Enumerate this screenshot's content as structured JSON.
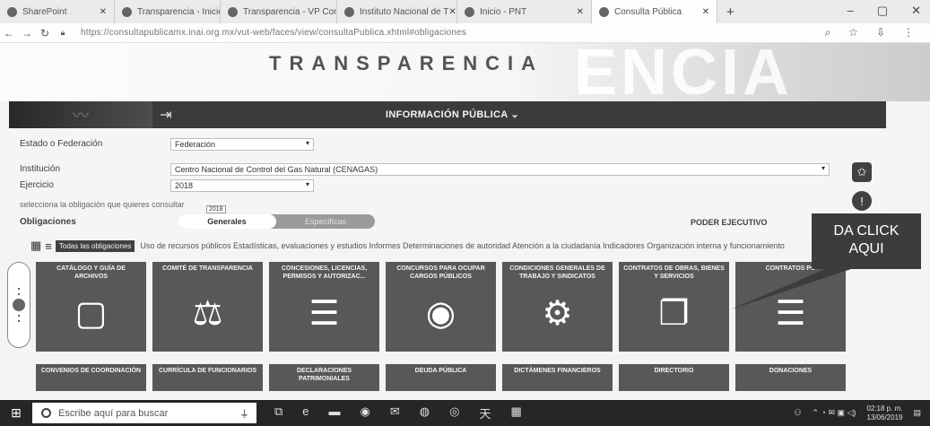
{
  "browser": {
    "tabs": [
      {
        "title": "SharePoint",
        "icon": "sharepoint-icon"
      },
      {
        "title": "Transparencia - Inicio",
        "icon": "sharepoint-icon"
      },
      {
        "title": "Transparencia - VP Con",
        "icon": "sharepoint-icon"
      },
      {
        "title": "Instituto Nacional de T",
        "icon": "globe-icon"
      },
      {
        "title": "Inicio - PNT",
        "icon": "pnt-icon"
      },
      {
        "title": "Consulta Pública",
        "icon": "globe-icon"
      }
    ],
    "url": "https://consultapublicamx.inai.org.mx/vut-web/faces/view/consultaPublica.xhtml#obligaciones"
  },
  "header": {
    "title": "TRANSPARENCIA",
    "ghost_text": "ENCIA"
  },
  "navbar": {
    "title": "INFORMACIÓN PÚBLICA ⌄"
  },
  "form": {
    "estado_label": "Estado o Federación",
    "estado_value": "Federación",
    "institucion_label": "Institución",
    "institucion_value": "Centro Nacional de Control del Gas Natural (CENAGAS)",
    "ejercicio_label": "Ejercicio",
    "ejercicio_value": "2018",
    "tooltip": "2018",
    "hint": "selecciona la obligación que quieres consultar",
    "obligaciones_label": "Obligaciones",
    "toggle_on": "Generales",
    "toggle_off": "Específicas",
    "poder": "PODER EJECUTIVO"
  },
  "filters": {
    "chip": "Todas las obligaciones",
    "text": "Uso de recursos públicos  Estadísticas, evaluaciones y estudios  Informes  Determinaciones de autoridad  Atención a la ciudadanía  Indicadores  Organización interna y funcionamiento"
  },
  "tiles": [
    {
      "title": "CATÁLOGO Y GUÍA DE ARCHIVOS",
      "icon": "document-icon",
      "glyph": "▢"
    },
    {
      "title": "COMITÉ DE TRANSPARENCIA",
      "icon": "gavel-document-icon",
      "glyph": "⚖"
    },
    {
      "title": "CONCESIONES, LICENCIAS, PERMISOS Y AUTORIZAC...",
      "icon": "id-document-icon",
      "glyph": "☰"
    },
    {
      "title": "CONCURSOS PARA OCUPAR CARGOS PÚBLICOS",
      "icon": "search-person-icon",
      "glyph": "◉"
    },
    {
      "title": "CONDICIONES GENERALES DE TRABAJO Y SINDICATOS",
      "icon": "gears-icon",
      "glyph": "⚙"
    },
    {
      "title": "CONTRATOS DE OBRAS, BIENES Y SERVICIOS",
      "icon": "contract-check-icon",
      "glyph": "❐"
    },
    {
      "title": "CONTRATOS PO",
      "icon": "person-document-icon",
      "glyph": "☰"
    }
  ],
  "tiles_row2": [
    {
      "title": "CONVENIOS DE COORDINACIÓN"
    },
    {
      "title": "CURRÍCULA DE FUNCIONARIOS"
    },
    {
      "title": "DECLARACIONES PATRIMONIALES"
    },
    {
      "title": "DEUDA PÚBLICA"
    },
    {
      "title": "DICTÁMENES FINANCIEROS"
    },
    {
      "title": "DIRECTORIO"
    },
    {
      "title": "DONACIONES"
    }
  ],
  "callout": {
    "line1": "DA CLICK",
    "line2": "AQUI"
  },
  "taskbar": {
    "search_placeholder": "Escribe aquí para buscar",
    "time": "02:18 p. m.",
    "date": "13/06/2019"
  }
}
